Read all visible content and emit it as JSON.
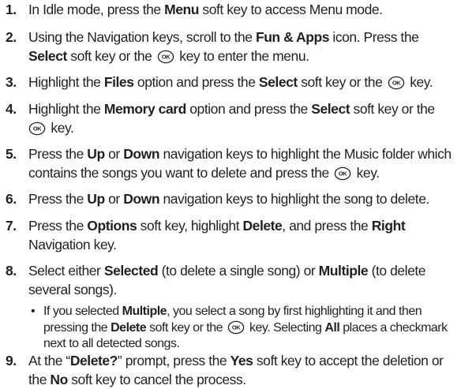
{
  "steps": [
    {
      "n": "1.",
      "a": "In Idle mode, press the ",
      "b1": "Menu",
      "c": " soft key to access Menu mode."
    },
    {
      "n": "2.",
      "a": "Using the Navigation keys, scroll to the ",
      "b1": "Fun & Apps",
      "c": " icon. Press the ",
      "b2": "Select",
      "d": " soft key or the",
      "e": " key to enter the menu."
    },
    {
      "n": "3.",
      "a": "Highlight the ",
      "b1": "Files",
      "c": " option and press the ",
      "b2": "Select",
      "d": " soft key or the",
      "e": " key."
    },
    {
      "n": "4.",
      "a": "Highlight the ",
      "b1": "Memory card",
      "c": " option and press the ",
      "b2": "Select",
      "d": " soft key or the",
      "e": " key."
    },
    {
      "n": "5.",
      "a": "Press the ",
      "b1": "Up",
      "c": " or ",
      "b2": "Down",
      "d": " navigation keys to highlight the Music folder which contains the songs you want to delete and press the",
      "e": " key."
    },
    {
      "n": "6.",
      "a": "Press the ",
      "b1": "Up",
      "c": " or ",
      "b2": "Down",
      "d": " navigation keys to highlight the song to delete."
    },
    {
      "n": "7.",
      "a": "Press the ",
      "b1": "Options",
      "c": " soft key, highlight ",
      "b2": "Delete",
      "d": ", and press the ",
      "b3": "Right",
      "e": " Navigation key."
    },
    {
      "n": "8.",
      "a": "Select either ",
      "b1": "Selected",
      "c": " (to delete a single song) or ",
      "b2": "Multiple",
      "d": " (to delete several songs)."
    },
    {
      "n": "9.",
      "a": "At the “",
      "b1": "Delete?",
      "c": "” prompt, press the ",
      "b2": "Yes",
      "d": " soft key to accept the deletion or the ",
      "b3": "No",
      "e": " soft key to cancel the process."
    }
  ],
  "bullet": {
    "mark": "•",
    "a": "If you selected ",
    "b1": "Multiple",
    "c": ", you select a song by first highlighting it and then pressing the ",
    "b2": "Delete",
    "d": " soft key or the",
    "e": " key. Selecting ",
    "b3": "All",
    "f": " places a checkmark next to all detected songs."
  },
  "ok_key": {
    "label": "OK",
    "icon": "ok-key-icon"
  }
}
